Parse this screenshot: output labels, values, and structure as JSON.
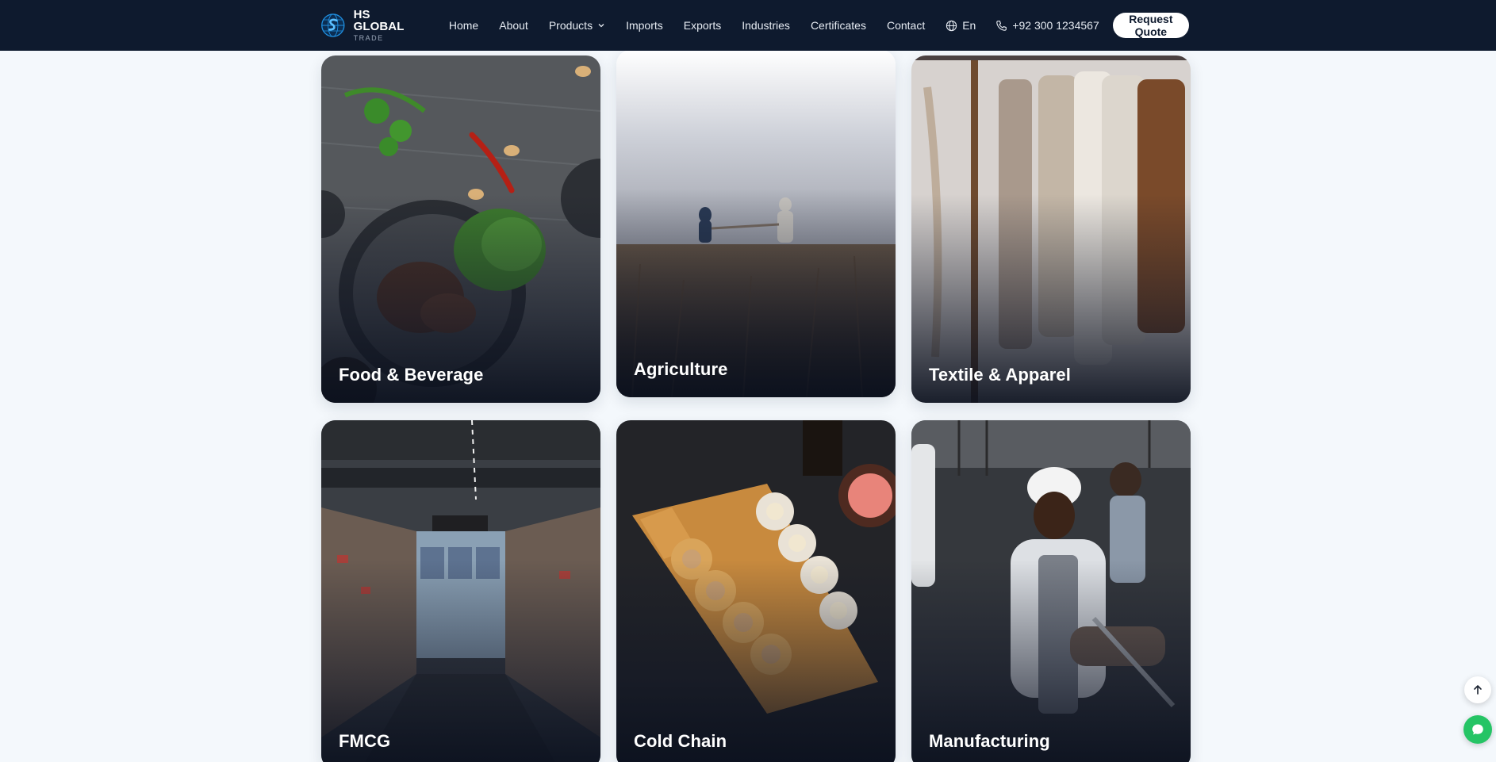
{
  "brand": {
    "title": "HS GLOBAL",
    "subtitle": "TRADE",
    "logo_icon": "globe-hs-logo-icon"
  },
  "nav": {
    "links": [
      {
        "label": "Home"
      },
      {
        "label": "About"
      },
      {
        "label": "Products",
        "icon": "chevron-down-icon"
      },
      {
        "label": "Imports"
      },
      {
        "label": "Exports"
      },
      {
        "label": "Industries"
      },
      {
        "label": "Certificates"
      },
      {
        "label": "Contact"
      }
    ],
    "language": "En",
    "phone": "+92 300 1234567",
    "cta": "Request Quote"
  },
  "industries": [
    {
      "label": "Food & Beverage"
    },
    {
      "label": "Agriculture"
    },
    {
      "label": "Textile & Apparel"
    },
    {
      "label": "FMCG"
    },
    {
      "label": "Cold Chain"
    },
    {
      "label": "Manufacturing"
    }
  ],
  "floating": {
    "scroll_top_icon": "arrow-up-icon",
    "chat_icon": "chat-bubble-icon"
  },
  "colors": {
    "nav_bg": "#0e1a2e",
    "page_bg": "#f4f8fc",
    "chat_green": "#25c465"
  }
}
